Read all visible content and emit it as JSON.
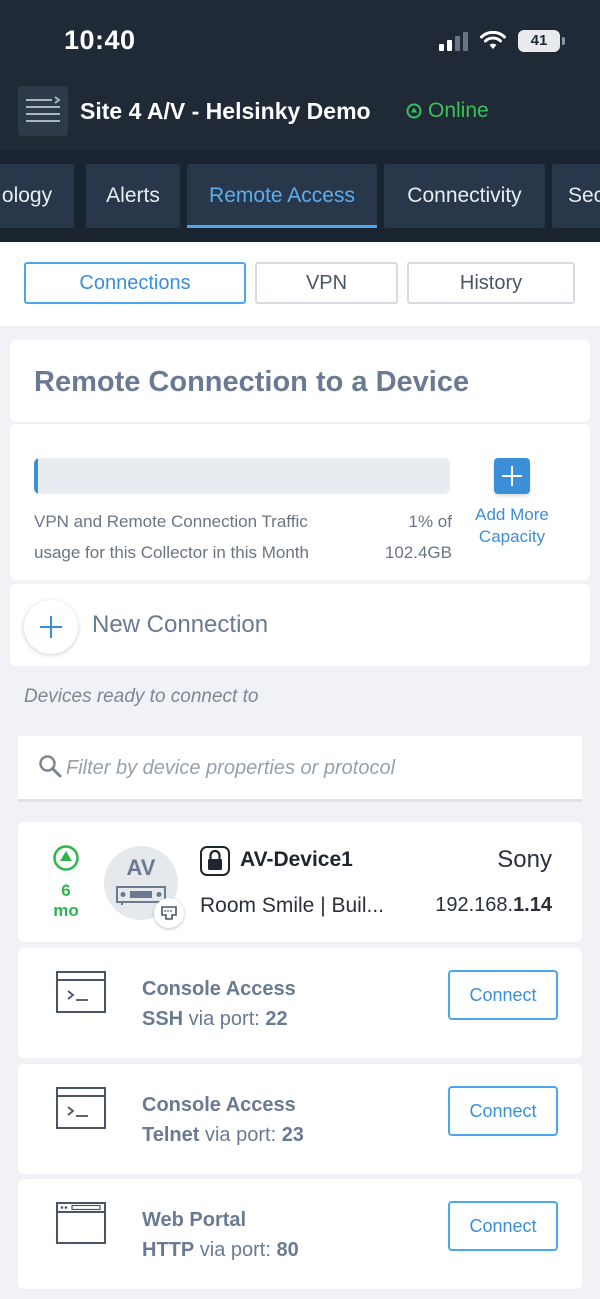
{
  "status_bar": {
    "time": "10:40",
    "battery": "41"
  },
  "header": {
    "menu_icon": "menu-expand-icon",
    "site_title": "Site 4 A/V - Helsinky Demo",
    "online_status": "Online",
    "online_color": "#3ac25a"
  },
  "tabs": [
    {
      "label": "ology"
    },
    {
      "label": "Alerts"
    },
    {
      "label": "Remote Access",
      "active": true
    },
    {
      "label": "Connectivity"
    },
    {
      "label": "Sec"
    }
  ],
  "subtabs": [
    {
      "label": "Connections",
      "active": true
    },
    {
      "label": "VPN"
    },
    {
      "label": "History"
    }
  ],
  "remote": {
    "title": "Remote Connection to a Device",
    "usage_fraction": 0.01,
    "usage_text_line1": "VPN and Remote Connection Traffic",
    "usage_text_line2": "usage for this Collector in this Month",
    "usage_pct": "1% of",
    "usage_total": "102.4GB",
    "add_more_line1": "Add More",
    "add_more_line2": "Capacity"
  },
  "new_connection": {
    "label": "New Connection"
  },
  "devices_section": {
    "label": "Devices ready to connect to",
    "filter_placeholder": "Filter by device properties or protocol"
  },
  "device": {
    "uptime_value": "6",
    "uptime_unit": "mo",
    "avatar_text": "AV",
    "name": "AV-Device1",
    "vendor": "Sony",
    "room": "Room Smile | Buil...",
    "ip_prefix": "192.168.",
    "ip_suffix": "1.14"
  },
  "services": [
    {
      "icon": "terminal-icon",
      "title": "Console Access",
      "protocol": "SSH",
      "via": " via port: ",
      "port": "22",
      "button": "Connect"
    },
    {
      "icon": "terminal-icon",
      "title": "Console Access",
      "protocol": "Telnet",
      "via": " via port: ",
      "port": "23",
      "button": "Connect"
    },
    {
      "icon": "browser-window-icon",
      "title": "Web Portal",
      "protocol": "HTTP",
      "via": " via port: ",
      "port": "80",
      "button": "Connect"
    }
  ],
  "colors": {
    "accent": "#3b8fd6",
    "header_bg": "#1f2a36",
    "tab_bg": "#29374a",
    "online": "#3ac25a"
  }
}
